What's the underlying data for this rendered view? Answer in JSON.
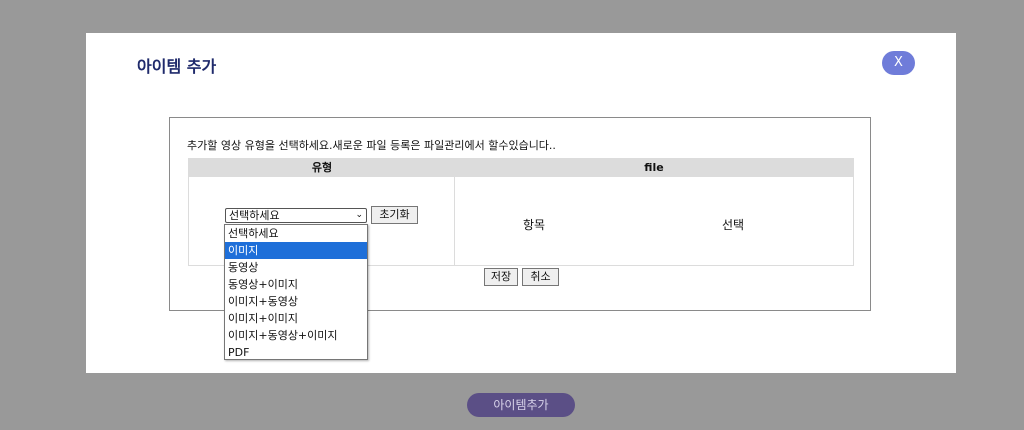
{
  "modal": {
    "title": "아이템 추가",
    "close_label": "X"
  },
  "form": {
    "instruction": "추가할 영상 유형을 선택하세요.새로운 파일 등록은 파일관리에서 할수있습니다..",
    "col_type": "유형",
    "col_file": "file",
    "select_value": "선택하세요",
    "reset_label": "초기화",
    "item_label": "항목",
    "choose_label": "선택",
    "save_label": "저장",
    "cancel_label": "취소"
  },
  "dropdown": {
    "options": [
      "선택하세요",
      "이미지",
      "동영상",
      "동영상+이미지",
      "이미지+동영상",
      "이미지+이미지",
      "이미지+동영상+이미지",
      "PDF"
    ],
    "highlighted": "이미지"
  },
  "footer": {
    "add_item_label": "아이템추가"
  },
  "colors": {
    "overlay": "#999999",
    "title": "#1f2a6b",
    "close_button": "#6f7cd9",
    "highlight": "#1e6fd9",
    "add_item_button": "#5b4f86"
  }
}
